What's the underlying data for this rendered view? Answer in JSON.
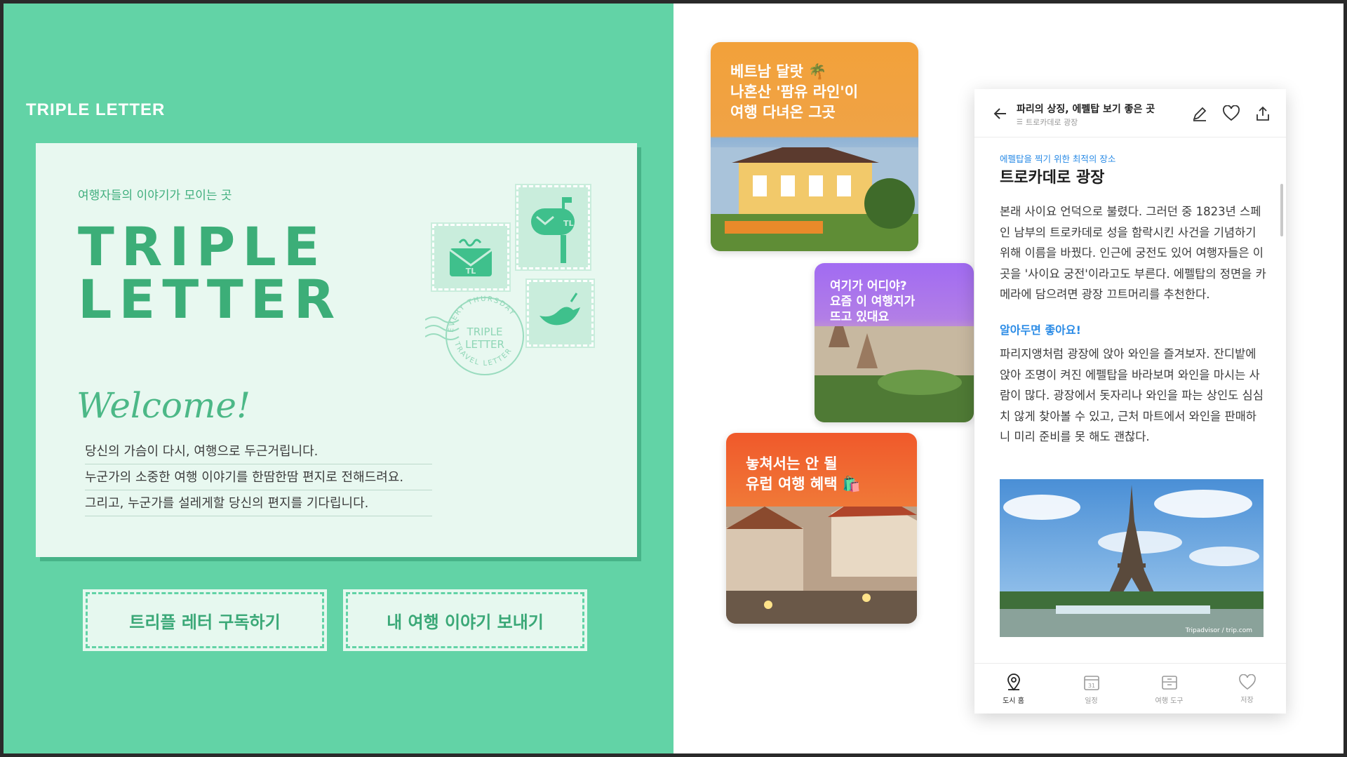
{
  "left": {
    "brand": "TRIPLE LETTER",
    "tagline": "여행자들의 이야기가 모이는 곳",
    "title_line1": "TRIPLE",
    "title_line2": "LETTER",
    "welcome": "Welcome!",
    "lines": [
      "당신의 가슴이 다시, 여행으로 두근거립니다.",
      "누군가의 소중한 여행 이야기를 한땀한땀 편지로 전해드려요.",
      "그리고, 누군가를 설레게할 당신의 편지를 기다립니다."
    ],
    "postmark": {
      "ring_top": "EVERY THURSDAY",
      "ring_bottom": "TRAVEL LETTER",
      "center1": "TRIPLE",
      "center2": "LETTER"
    },
    "stamp_mark": "TL",
    "buttons": {
      "subscribe": "트리플 레터 구독하기",
      "send": "내 여행 이야기 보내기"
    }
  },
  "cards": [
    {
      "title": "베트남 달랏 🌴\n나혼산 '팜유 라인'이\n여행 다녀온 그곳"
    },
    {
      "title": "여기가 어디야?\n요즘 이 여행지가\n뜨고 있대요"
    },
    {
      "title": "놓쳐서는 안 될\n유럽 여행 혜택 🛍️"
    }
  ],
  "phone": {
    "header_title": "파리의 상징, 에펠탑 보기 좋은 곳",
    "header_sub": "트로카데로 광장",
    "kicker": "에펠탑을 찍기 위한 최적의 장소",
    "place_title": "트로카데로 광장",
    "para1": "본래 사이요 언덕으로 불렸다. 그러던 중 1823년 스페인 남부의 트로카데로 성을 함락시킨 사건을 기념하기 위해 이름을 바꿨다. 인근에 궁전도 있어 여행자들은 이곳을 '사이요 궁전'이라고도 부른다. 에펠탑의 정면을 카메라에 담으려면 광장 끄트머리를 추천한다.",
    "tip_heading": "알아두면 좋아요!",
    "para2": "파리지앵처럼 광장에 앉아 와인을 즐겨보자. 잔디밭에 앉아 조명이 켜진 에펠탑을 바라보며 와인을 마시는 사람이 많다. 광장에서 돗자리나 와인을 파는 상인도 심심치 않게 찾아볼 수 있고, 근처 마트에서 와인을 판매하니 미리 준비를 못 해도 괜찮다.",
    "photo_credit": "Tripadvisor / trip.com",
    "nav": [
      {
        "label": "도시 홈",
        "icon": "map-pin-icon",
        "active": true
      },
      {
        "label": "일정",
        "icon": "calendar-icon",
        "badge": "31"
      },
      {
        "label": "여행 도구",
        "icon": "tools-icon"
      },
      {
        "label": "저장",
        "icon": "heart-icon"
      }
    ]
  },
  "colors": {
    "mint": "#62d3a6",
    "accent_blue": "#2a8be6",
    "letter_bg": "#e8f8f0",
    "green_text": "#3cae78"
  }
}
